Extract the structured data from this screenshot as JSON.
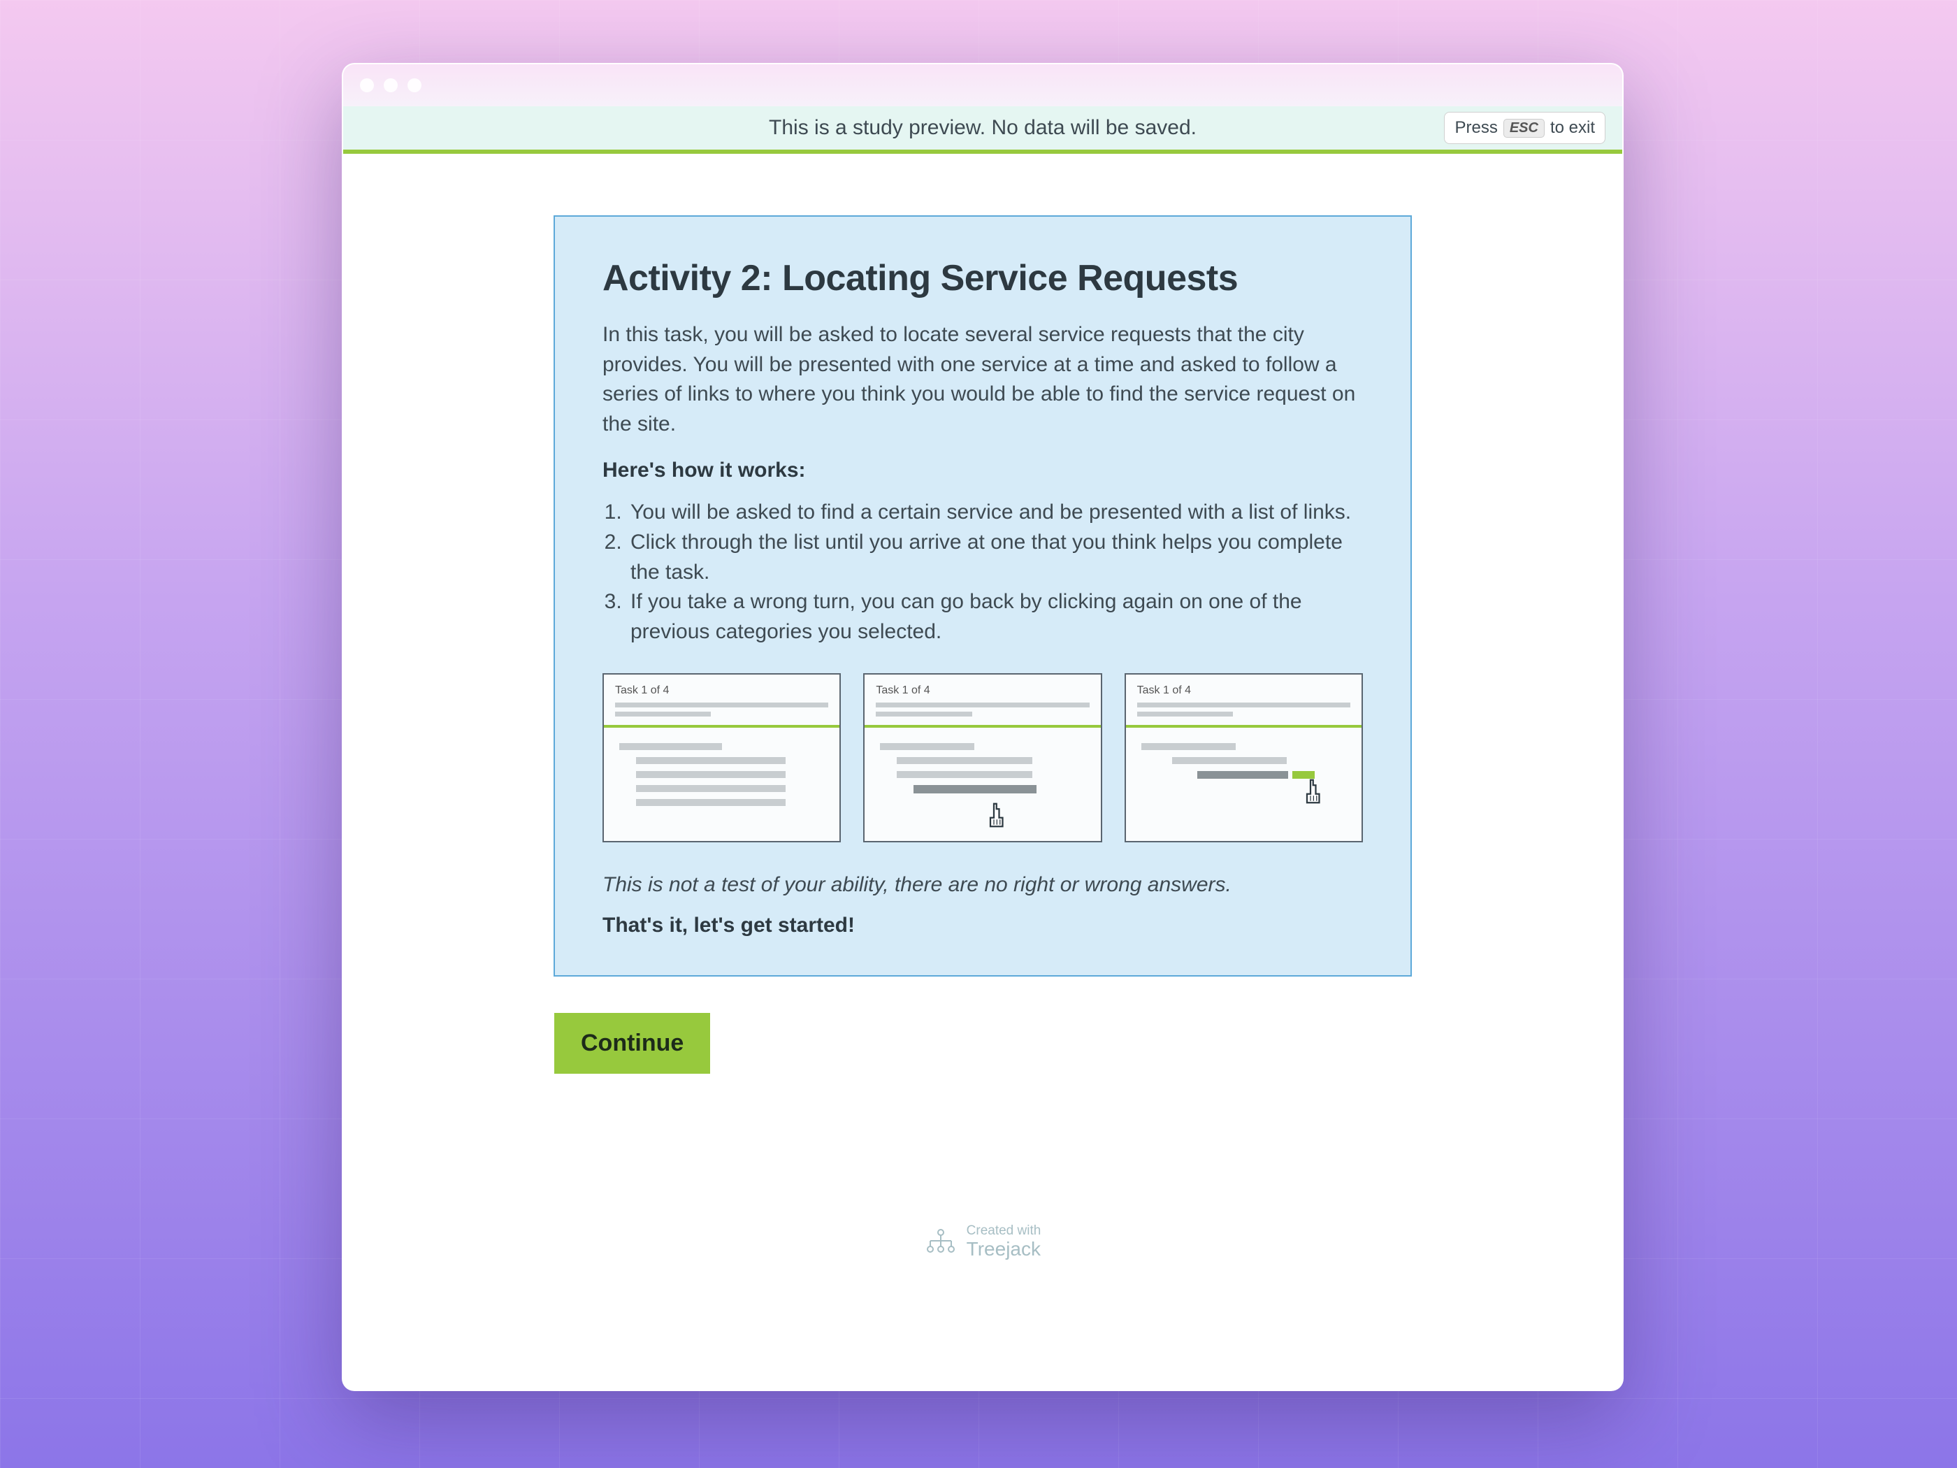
{
  "banner": {
    "preview_text": "This is a study preview. No data will be saved.",
    "exit_prefix": "Press",
    "exit_key": "ESC",
    "exit_suffix": "to exit"
  },
  "activity": {
    "title": "Activity 2: Locating Service Requests",
    "description": "In this task, you will be asked to locate several service requests that the city provides. You will be presented with one service at a time and asked to follow a series of links to where you think you would be able to find the service request on the site.",
    "how_label": "Here's how it works:",
    "steps": [
      "You will be asked to find a certain service and be presented with a list of links.",
      "Click through the list until you arrive at one that you think helps you complete the task.",
      "If you take a wrong turn, you can go back by clicking again on one of the previous categories you selected."
    ],
    "illus_task_label": "Task 1 of 4",
    "disclaimer": "This is not a test of your ability, there are no right or wrong answers.",
    "closing": "That's it, let's get started!"
  },
  "continue_label": "Continue",
  "footer": {
    "line1": "Created with",
    "line2": "Treejack"
  }
}
